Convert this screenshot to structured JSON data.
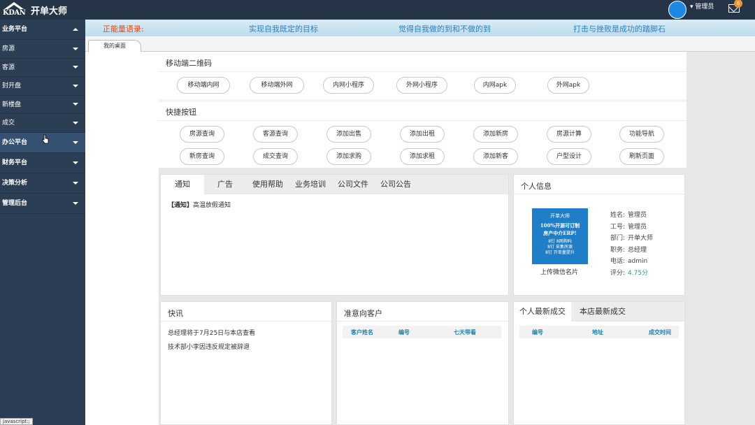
{
  "app": {
    "logo_text": "KDAN",
    "name": "开单大师"
  },
  "header": {
    "user": "管理员",
    "mail_count": "6"
  },
  "sidebar": {
    "items": [
      {
        "label": "业务平台",
        "main": true,
        "expanded": true
      },
      {
        "label": "房源"
      },
      {
        "label": "客源"
      },
      {
        "label": "封开盘"
      },
      {
        "label": "新楼盘"
      },
      {
        "label": "成交"
      },
      {
        "label": "办公平台",
        "main": true
      },
      {
        "label": "财务平台",
        "main": true
      },
      {
        "label": "决策分析",
        "main": true
      },
      {
        "label": "管理后台",
        "main": true
      }
    ],
    "status": "javascript:;"
  },
  "motto": {
    "lead": "正能量语录:",
    "quote1": "实现自我既定的目标",
    "quote2": "觉得自我做的到和不做的到",
    "quote3": "打击与挫败是成功的踏脚石"
  },
  "tabs": {
    "desktop": "我的桌面"
  },
  "qr": {
    "title": "移动端二维码",
    "buttons": [
      "移动端内网",
      "移动端外网",
      "内网小程序",
      "外网小程序",
      "内网apk",
      "外网apk"
    ]
  },
  "quick": {
    "title": "快捷按钮",
    "row1": [
      "房源查询",
      "客源查询",
      "添加出售",
      "添加出租",
      "添加新房",
      "房源计算",
      "功能导航"
    ],
    "row2": [
      "新房查询",
      "成交查询",
      "添加求购",
      "添加求租",
      "添加新客",
      "户型设计",
      "刷新页面"
    ]
  },
  "notice_panel": {
    "tabs": [
      "通知",
      "广告",
      "使用帮助",
      "业务培训",
      "公司文件",
      "公司公告"
    ],
    "item_tag": "【通知】",
    "item_text": "高温放假通知"
  },
  "profile": {
    "title": "个人信息",
    "card": {
      "brand": "开单大师",
      "line1": "100%开源可订制",
      "line2": "房产中介ERP!",
      "feat1": "8钉 8网购码",
      "feat2": "8钉 采集房源",
      "feat3": "8钉 开单量提升"
    },
    "upload": "上传微信名片",
    "name_label": "姓名:",
    "name": "管理员",
    "id_label": "工号:",
    "id": "管理员",
    "dept_label": "部门:",
    "dept": "开单大师",
    "role_label": "职务:",
    "role": "总经理",
    "phone_label": "电话:",
    "phone": "admin",
    "score_label": "评分:",
    "score": "4.75分"
  },
  "news": {
    "title": "快讯",
    "items": [
      "总经理将于7月25日与本店查看",
      "技术部小李因违反规定被辞退"
    ]
  },
  "customers": {
    "title": "准意向客户",
    "columns": [
      "客户姓名",
      "编号",
      "七天带看"
    ]
  },
  "deals": {
    "tabs": [
      "个人最新成交",
      "本店最新成交"
    ],
    "columns": [
      "编号",
      "地址",
      "成交时间"
    ]
  },
  "colors": {
    "sidebar": "#2b3e54",
    "topbar": "#253447",
    "accent": "#1f7ec7",
    "motto_lead": "#e8481a",
    "motto_text": "#2d7fc0"
  }
}
